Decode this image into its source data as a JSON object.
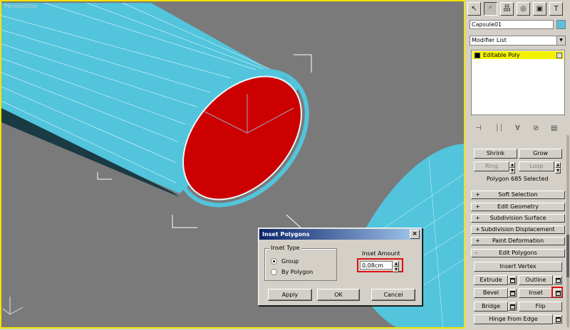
{
  "viewport": {
    "label": "Perspective",
    "colors": {
      "background": "#7a7a7a",
      "mesh": "#4cc6e0",
      "selected_face": "#cc0000",
      "border": "#f4e400"
    }
  },
  "dialog": {
    "title": "Inset Polygons",
    "close_label": "×",
    "inset_type_legend": "Inset Type",
    "option_group": "Group",
    "option_by_polygon": "By Polygon",
    "selected_option": "Group",
    "inset_amount_label": "Inset Amount",
    "inset_amount_value": "0,08cm",
    "apply_label": "Apply",
    "ok_label": "OK",
    "cancel_label": "Cancel"
  },
  "panel": {
    "tabs": [
      {
        "icon": "create-icon",
        "glyph": "↖"
      },
      {
        "icon": "modify-icon",
        "glyph": "◜"
      },
      {
        "icon": "hierarchy-icon",
        "glyph": "品"
      },
      {
        "icon": "motion-icon",
        "glyph": "◎"
      },
      {
        "icon": "display-icon",
        "glyph": "▣"
      },
      {
        "icon": "utilities-icon",
        "glyph": "T"
      }
    ],
    "object_name": "Capsule01",
    "object_color": "#5bc0de",
    "modifier_list_label": "Modifier List",
    "stack_item": "Editable Poly",
    "selection": {
      "shrink": "Shrink",
      "grow": "Grow",
      "ring": "Ring",
      "loop": "Loop",
      "status": "Polygon 685 Selected"
    },
    "rollouts": [
      {
        "sign": "+",
        "label": "Soft Selection"
      },
      {
        "sign": "+",
        "label": "Edit Geometry"
      },
      {
        "sign": "+",
        "label": "Subdivision Surface"
      },
      {
        "sign": "+",
        "label": "Subdivision Displacement"
      },
      {
        "sign": "+",
        "label": "Paint Deformation"
      },
      {
        "sign": "-",
        "label": "Edit Polygons"
      }
    ],
    "edit_polygons": {
      "insert_vertex": "Insert Vertex",
      "extrude": "Extrude",
      "outline": "Outline",
      "bevel": "Bevel",
      "inset": "Inset",
      "bridge": "Bridge",
      "flip": "Flip",
      "hinge_from_edge": "Hinge From Edge"
    }
  }
}
